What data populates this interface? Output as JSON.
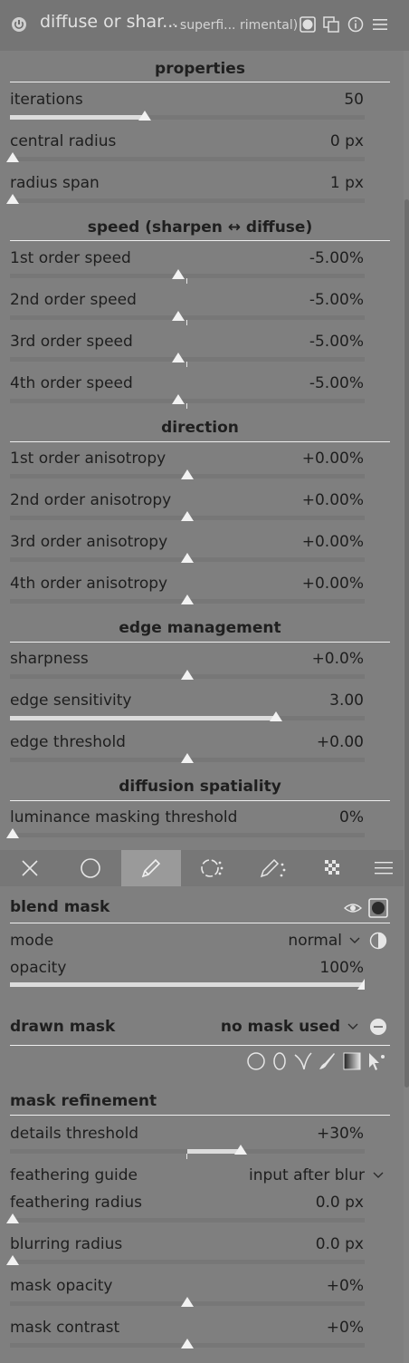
{
  "header": {
    "title": "diffuse or shar...",
    "subtitle_a": "· superfi...",
    "subtitle_b": "rimental)"
  },
  "sections": {
    "properties": "properties",
    "speed": "speed (sharpen ↔ diffuse)",
    "direction": "direction",
    "edge": "edge management",
    "spatiality": "diffusion spatiality"
  },
  "sliders": {
    "iterations": {
      "label": "iterations",
      "value": "50",
      "fraction": 0.38
    },
    "central_radius": {
      "label": "central radius",
      "value": "0 px",
      "fraction": 0.0
    },
    "radius_span": {
      "label": "radius span",
      "value": "1 px",
      "fraction": 0.0
    },
    "speed1": {
      "label": "1st order speed",
      "value": "-5.00%",
      "fraction": 0.475
    },
    "speed2": {
      "label": "2nd order speed",
      "value": "-5.00%",
      "fraction": 0.475
    },
    "speed3": {
      "label": "3rd order speed",
      "value": "-5.00%",
      "fraction": 0.475
    },
    "speed4": {
      "label": "4th order speed",
      "value": "-5.00%",
      "fraction": 0.475
    },
    "aniso1": {
      "label": "1st order anisotropy",
      "value": "+0.00%",
      "fraction": 0.5
    },
    "aniso2": {
      "label": "2nd order anisotropy",
      "value": "+0.00%",
      "fraction": 0.5
    },
    "aniso3": {
      "label": "3rd order anisotropy",
      "value": "+0.00%",
      "fraction": 0.5
    },
    "aniso4": {
      "label": "4th order anisotropy",
      "value": "+0.00%",
      "fraction": 0.5
    },
    "sharpness": {
      "label": "sharpness",
      "value": "+0.0%",
      "fraction": 0.5
    },
    "edge_sensitivity": {
      "label": "edge sensitivity",
      "value": "3.00",
      "fraction": 0.75
    },
    "edge_threshold": {
      "label": "edge threshold",
      "value": "+0.00",
      "fraction": 0.5
    },
    "lum_mask": {
      "label": "luminance masking threshold",
      "value": "0%",
      "fraction": 0.0
    }
  },
  "blend": {
    "title": "blend mask",
    "mode_label": "mode",
    "mode_value": "normal",
    "opacity_label": "opacity",
    "opacity_value": "100%",
    "opacity_fraction": 1.0
  },
  "drawn": {
    "title": "drawn mask",
    "status": "no mask used"
  },
  "refine": {
    "title": "mask refinement",
    "details_label": "details threshold",
    "details_value": "+30%",
    "feather_guide_label": "feathering guide",
    "feather_guide_value": "input after blur",
    "feather_radius_label": "feathering radius",
    "feather_radius_value": "0.0 px",
    "blur_radius_label": "blurring radius",
    "blur_radius_value": "0.0 px",
    "mask_opacity_label": "mask opacity",
    "mask_opacity_value": "+0%",
    "mask_contrast_label": "mask contrast",
    "mask_contrast_value": "+0%"
  },
  "icons": {
    "power": "power-icon",
    "instance": "instance-icon",
    "reset": "reset-icon",
    "presets": "presets-icon"
  }
}
